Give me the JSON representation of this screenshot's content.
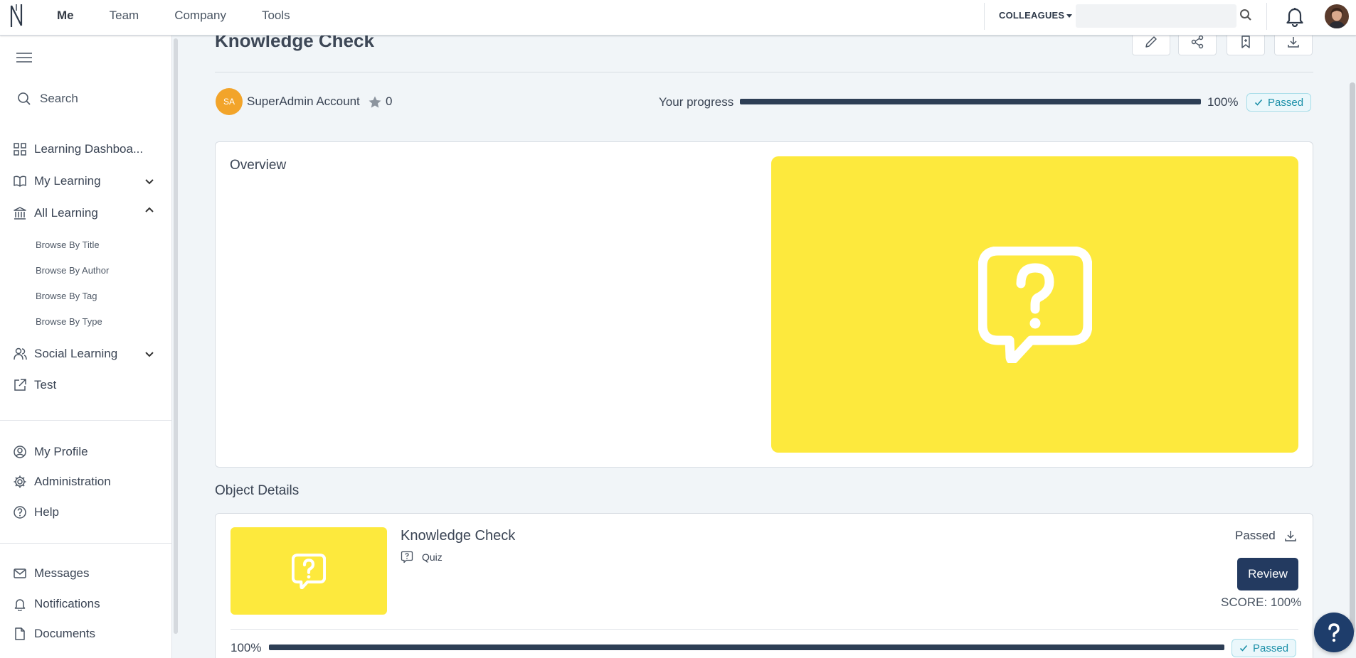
{
  "topnav": {
    "items": [
      "Me",
      "Team",
      "Company",
      "Tools"
    ],
    "active_index": 0
  },
  "header": {
    "colleagues_label": "COLLEAGUES",
    "search_placeholder": ""
  },
  "sidebar": {
    "search_label": "Search",
    "items": [
      {
        "label": "Learning Dashboa...",
        "icon": "grid-icon"
      },
      {
        "label": "My Learning",
        "icon": "book-icon",
        "chevron": "down"
      },
      {
        "label": "All Learning",
        "icon": "library-icon",
        "chevron": "up"
      },
      {
        "label": "Social Learning",
        "icon": "users-icon",
        "chevron": "down"
      },
      {
        "label": "Test",
        "icon": "external-link-icon"
      }
    ],
    "sub_items": [
      "Browse By Title",
      "Browse By Author",
      "Browse By Tag",
      "Browse By Type"
    ],
    "bottom_items": [
      {
        "label": "My Profile",
        "icon": "user-circle-icon"
      },
      {
        "label": "Administration",
        "icon": "gear-icon"
      },
      {
        "label": "Help",
        "icon": "help-circle-icon"
      }
    ],
    "footer_items": [
      {
        "label": "Messages",
        "icon": "mail-icon"
      },
      {
        "label": "Notifications",
        "icon": "bell-icon"
      },
      {
        "label": "Documents",
        "icon": "file-icon"
      }
    ]
  },
  "page": {
    "title": "Knowledge Check",
    "actions": [
      "edit-icon",
      "share-icon",
      "bookmark-icon",
      "download-icon"
    ],
    "author": {
      "initials": "SA",
      "name": "SuperAdmin Account"
    },
    "rating": "0",
    "progress_label": "Your progress",
    "progress_value": 1.0,
    "progress_text": "100%",
    "status": "Passed"
  },
  "overview": {
    "title": "Overview",
    "hero_icon": "quiz-bubble-icon",
    "hero_color": "#fde93d"
  },
  "object_details": {
    "section_title": "Object Details",
    "title": "Knowledge Check",
    "type": "Quiz",
    "status": "Passed",
    "review_label": "Review",
    "score_text": "SCORE: 100%",
    "progress_text": "100%",
    "progress_value": 1.0,
    "badge": "Passed"
  },
  "colors": {
    "accent": "#233a60",
    "progress": "#2d3e55",
    "badge_text": "#1a8fa8",
    "avatar": "#f2a42a"
  }
}
